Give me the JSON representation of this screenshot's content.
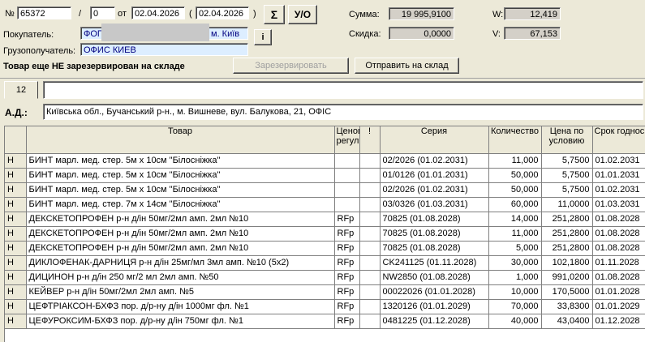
{
  "header": {
    "num_label": "№",
    "doc_number": "65372",
    "slash": "/",
    "sub_number": "0",
    "from_label": "от",
    "date_from": "02.04.2026",
    "paren_open": "(",
    "date_to": "02.04.2026",
    "paren_close": ")",
    "sigma_label": "Σ",
    "uo_label": "У/О",
    "sum_label": "Сумма:",
    "sum_value": "19 995,9100",
    "discount_label": "Скидка:",
    "discount_value": "0,0000",
    "w_label": "W:",
    "w_value": "12,419",
    "v_label": "V:",
    "v_value": "67,153"
  },
  "buyer": {
    "label": "Покупатель:",
    "value_prefix": "ФОП",
    "value_suffix": "м. Київ",
    "info_button": "i"
  },
  "consignee": {
    "label": "Грузополучатель:",
    "value": "ОФИС КИЕВ"
  },
  "status": {
    "text": "Товар еще НЕ зарезервирован на складе",
    "reserve_button": "Зарезервировать",
    "send_button": "Отправить на склад"
  },
  "tab": {
    "number": "12"
  },
  "address": {
    "label": "А.Д.:",
    "value": "Київська обл., Бучанський р-н., м. Вишневе, вул. Балукова, 21, ОФІС"
  },
  "table": {
    "columns": [
      "",
      "Товар",
      "Ценов регул",
      "!",
      "Серия",
      "Количество",
      "Цена по условию",
      "Срок годнос"
    ],
    "rows": [
      [
        "Н",
        "БИНТ марл. мед. стер. 5м х 10см \"Білосніжка\"",
        "",
        "",
        "02/2026 (01.02.2031)",
        "11,000",
        "5,7500",
        "01.02.2031"
      ],
      [
        "Н",
        "БИНТ марл. мед. стер. 5м х 10см \"Білосніжка\"",
        "",
        "",
        "01/0126 (01.01.2031)",
        "50,000",
        "5,7500",
        "01.01.2031"
      ],
      [
        "Н",
        "БИНТ марл. мед. стер. 5м х 10см \"Білосніжка\"",
        "",
        "",
        "02/2026 (01.02.2031)",
        "50,000",
        "5,7500",
        "01.02.2031"
      ],
      [
        "Н",
        "БИНТ марл. мед. стер. 7м х 14см \"Білосніжка\"",
        "",
        "",
        "03/0326 (01.03.2031)",
        "60,000",
        "11,0000",
        "01.03.2031"
      ],
      [
        "Н",
        "ДЕКСКЕТОПРОФЕН р-н д/ін 50мг/2мл амп. 2мл №10",
        "RFp",
        "",
        "70825 (01.08.2028)",
        "14,000",
        "251,2800",
        "01.08.2028"
      ],
      [
        "Н",
        "ДЕКСКЕТОПРОФЕН р-н д/ін 50мг/2мл амп. 2мл №10",
        "RFp",
        "",
        "70825 (01.08.2028)",
        "11,000",
        "251,2800",
        "01.08.2028"
      ],
      [
        "Н",
        "ДЕКСКЕТОПРОФЕН р-н д/ін 50мг/2мл амп. 2мл №10",
        "RFp",
        "",
        "70825 (01.08.2028)",
        "5,000",
        "251,2800",
        "01.08.2028"
      ],
      [
        "Н",
        "ДИКЛОФЕНАК-ДАРНИЦЯ р-н д/ін 25мг/мл 3мл амп. №10 (5х2)",
        "RFp",
        "",
        "CK241125 (01.11.2028)",
        "30,000",
        "102,1800",
        "01.11.2028"
      ],
      [
        "Н",
        "ДИЦИНОН р-н д/ін 250 мг/2 мл 2мл амп. №50",
        "RFp",
        "",
        "NW2850 (01.08.2028)",
        "1,000",
        "991,0200",
        "01.08.2028"
      ],
      [
        "Н",
        "КЕЙВЕР р-н д/ін 50мг/2мл 2мл амп. №5",
        "RFp",
        "",
        "00022026 (01.01.2028)",
        "10,000",
        "170,5000",
        "01.01.2028"
      ],
      [
        "Н",
        "ЦЕФТРІАКСОН-БХФЗ пор. д/р-ну д/ін 1000мг фл. №1",
        "RFp",
        "",
        "1320126 (01.01.2029)",
        "70,000",
        "33,8300",
        "01.01.2029"
      ],
      [
        "Н",
        "ЦЕФУРОКСИМ-БХФЗ пор. д/р-ну д/ін 750мг фл. №1",
        "RFp",
        "",
        "0481225 (01.12.2028)",
        "40,000",
        "43,0400",
        "01.12.2028"
      ]
    ]
  }
}
